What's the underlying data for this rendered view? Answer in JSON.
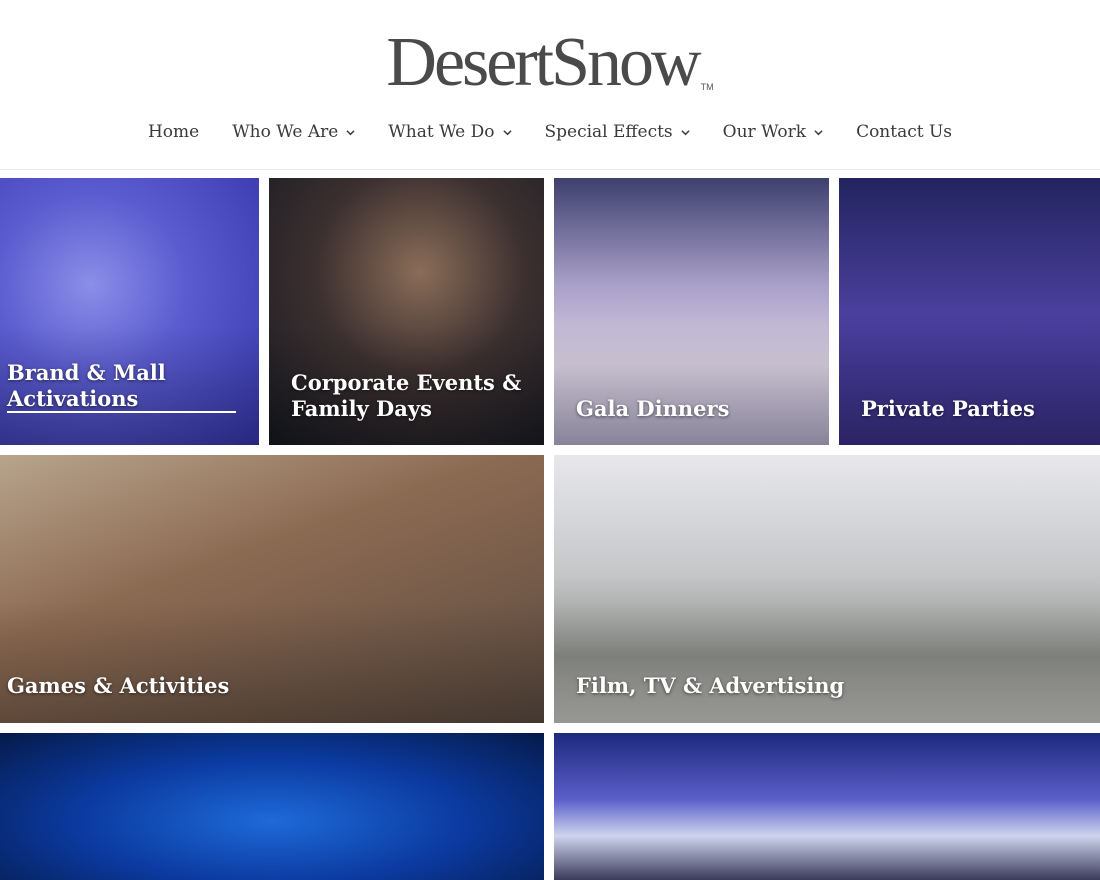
{
  "brand": {
    "logo_text": "DesertSnow",
    "trademark": "TM"
  },
  "nav": [
    {
      "label": "Home",
      "has_dropdown": false
    },
    {
      "label": "Who We Are",
      "has_dropdown": true
    },
    {
      "label": "What We Do",
      "has_dropdown": true
    },
    {
      "label": "Special Effects",
      "has_dropdown": true
    },
    {
      "label": "Our Work",
      "has_dropdown": true
    },
    {
      "label": "Contact Us",
      "has_dropdown": false
    }
  ],
  "tiles": [
    {
      "label": "Brand & Mall\nActivations",
      "active": true
    },
    {
      "label": "Corporate Events &\nFamily Days"
    },
    {
      "label": "Gala Dinners"
    },
    {
      "label": "Private Parties"
    },
    {
      "label": "Games & Activities"
    },
    {
      "label": "Film, TV & Advertising"
    },
    {
      "label": ""
    },
    {
      "label": ""
    }
  ]
}
